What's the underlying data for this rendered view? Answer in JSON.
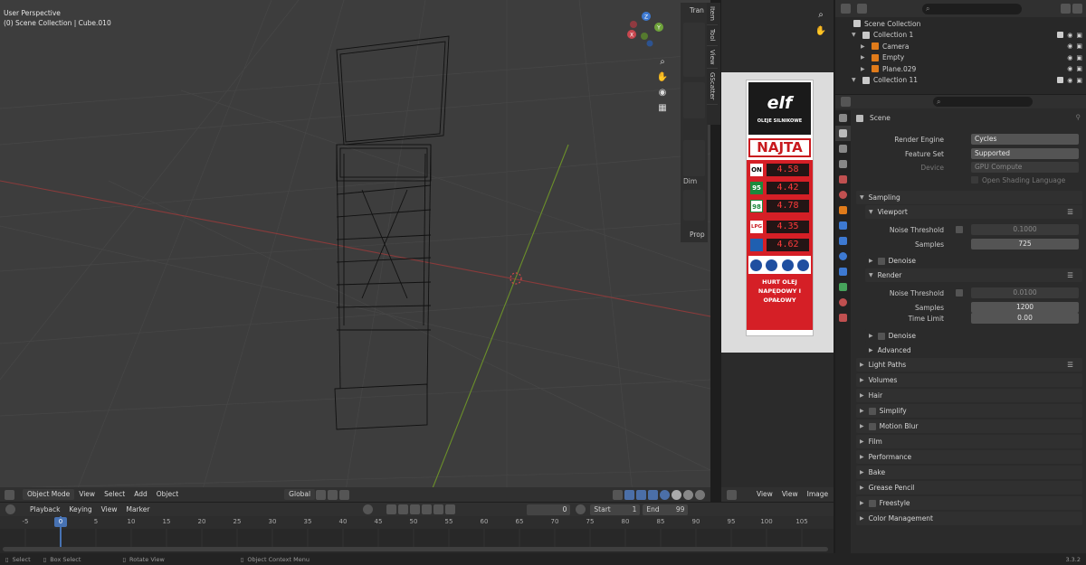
{
  "viewport": {
    "perspective": "User Perspective",
    "context": "(0) Scene Collection | Cube.010",
    "header": {
      "mode": "Object Mode",
      "menus": [
        "View",
        "Select",
        "Add",
        "Object"
      ],
      "orientation": "Global"
    },
    "side_tabs": [
      "Item",
      "Tool",
      "View",
      "GScatter"
    ],
    "sidebar_partial": {
      "tran": "Tran",
      "dim": "Dim",
      "prop": "Prop"
    },
    "gizmo_axes": [
      "Z",
      "Y",
      "X"
    ]
  },
  "image_editor": {
    "menus": [
      "View",
      "View",
      "Image"
    ]
  },
  "sign": {
    "brand": "elf",
    "brand_sub": "OLEJE SILNIKOWE",
    "station": "NAJTA",
    "prices": [
      {
        "fuel": "ON",
        "price": "4.58"
      },
      {
        "fuel": "95",
        "price": "4.42"
      },
      {
        "fuel": "98",
        "price": "4.78"
      },
      {
        "fuel": "LPG",
        "price": "4.35"
      },
      {
        "fuel": "",
        "price": "4.62"
      }
    ],
    "footer_text": "HURT OLEJ NAPĘDOWY I OPAŁOWY"
  },
  "timeline": {
    "menus": [
      "Playback",
      "Keying",
      "View",
      "Marker"
    ],
    "current_frame": "0",
    "start_label": "Start",
    "start": "1",
    "end_label": "End",
    "end": "99",
    "ticks": [
      "-5",
      "0",
      "5",
      "10",
      "15",
      "20",
      "25",
      "30",
      "35",
      "40",
      "45",
      "50",
      "55",
      "60",
      "65",
      "70",
      "75",
      "80",
      "85",
      "90",
      "95",
      "100",
      "105"
    ]
  },
  "statusbar": {
    "items": [
      "Select",
      "Box Select",
      "Rotate View",
      "Object Context Menu"
    ],
    "version": "3.3.2"
  },
  "outliner": {
    "items": [
      {
        "label": "Scene Collection",
        "depth": 0
      },
      {
        "label": "Collection 1",
        "depth": 1
      },
      {
        "label": "Camera",
        "depth": 2
      },
      {
        "label": "Empty",
        "depth": 2
      },
      {
        "label": "Plane.029",
        "depth": 2
      },
      {
        "label": "Collection 11",
        "depth": 1
      }
    ]
  },
  "properties": {
    "scene_label": "Scene",
    "render_engine_label": "Render Engine",
    "render_engine": "Cycles",
    "feature_set_label": "Feature Set",
    "feature_set": "Supported",
    "device_label": "Device",
    "device": "GPU Compute",
    "osl_label": "Open Shading Language",
    "sampling": "Sampling",
    "viewport": "Viewport",
    "noise_threshold_label": "Noise Threshold",
    "vp_noise_threshold": "0.1000",
    "samples_label": "Samples",
    "vp_samples": "725",
    "denoise": "Denoise",
    "render": "Render",
    "r_noise_threshold": "0.0100",
    "r_samples": "1200",
    "time_limit_label": "Time Limit",
    "time_limit": "0.00",
    "advanced": "Advanced",
    "panels": [
      "Light Paths",
      "Volumes",
      "Hair",
      "Simplify",
      "Motion Blur",
      "Film",
      "Performance",
      "Bake",
      "Grease Pencil",
      "Freestyle",
      "Color Management"
    ]
  }
}
